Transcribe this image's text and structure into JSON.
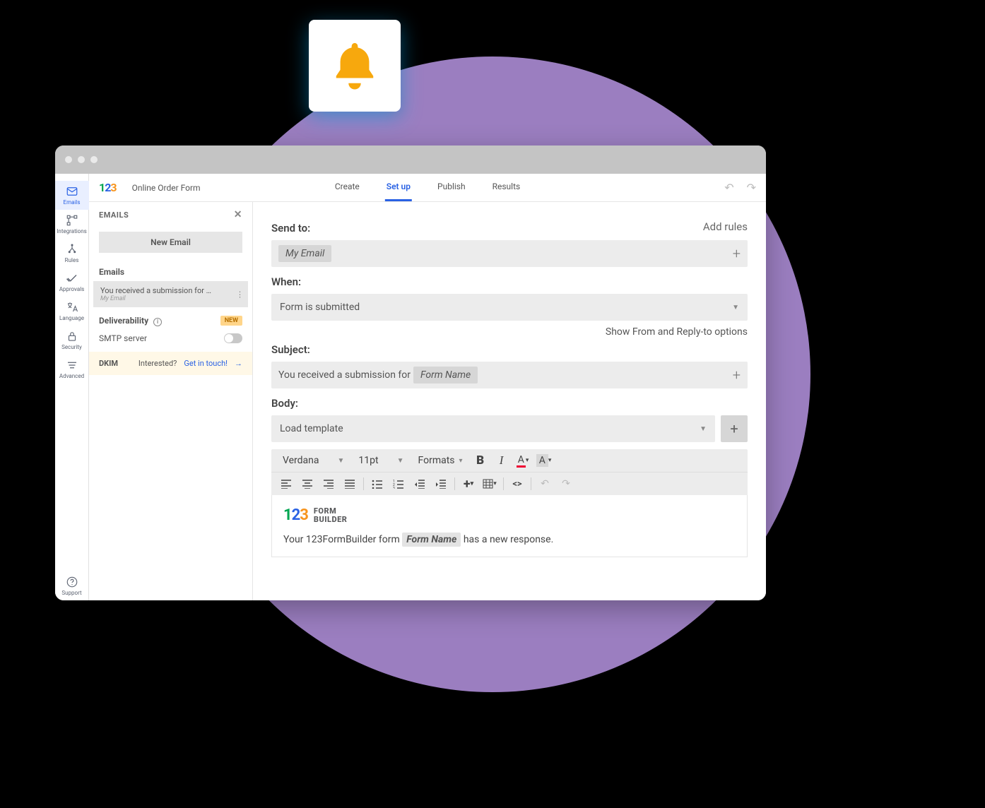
{
  "colors": {
    "accent": "#2a62e4",
    "bell": "#f7a80d",
    "purple": "#9b7ec0"
  },
  "form_title": "Online Order Form",
  "tabs": [
    "Create",
    "Set up",
    "Publish",
    "Results"
  ],
  "active_tab": "Set up",
  "navrail": [
    {
      "id": "emails",
      "label": "Emails"
    },
    {
      "id": "integrations",
      "label": "Integrations"
    },
    {
      "id": "rules",
      "label": "Rules"
    },
    {
      "id": "approvals",
      "label": "Approvals"
    },
    {
      "id": "language",
      "label": "Language"
    },
    {
      "id": "security",
      "label": "Security"
    },
    {
      "id": "advanced",
      "label": "Advanced"
    }
  ],
  "help_label": "Support",
  "emails_panel": {
    "heading": "EMAILS",
    "new_button": "New Email",
    "section_label": "Emails",
    "item": {
      "title": "You received a submission for …",
      "sub": "My Email"
    },
    "deliverability": {
      "label": "Deliverability",
      "badge": "NEW"
    },
    "smtp": {
      "label": "SMTP server",
      "enabled": false
    },
    "dkim": {
      "label": "DKIM",
      "text": "Interested?",
      "link": "Get in touch!"
    }
  },
  "main": {
    "send_to": {
      "label": "Send to:",
      "chip": "My Email",
      "add_rules": "Add rules"
    },
    "when": {
      "label": "When:",
      "value": "Form is submitted"
    },
    "show_from": "Show From and Reply-to options",
    "subject": {
      "label": "Subject:",
      "prefix": "You received a submission for",
      "chip": "Form Name"
    },
    "body_label": "Body:",
    "load_template": "Load template",
    "toolbar": {
      "font": "Verdana",
      "size": "11pt",
      "formats": "Formats"
    },
    "body_text": {
      "prefix": "Your 123FormBuilder form",
      "chip": "Form Name",
      "suffix": "has a new response."
    },
    "brand": {
      "line1": "FORM",
      "line2": "BUILDER"
    }
  }
}
